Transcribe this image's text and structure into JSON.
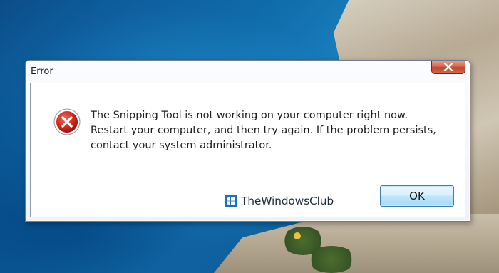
{
  "dialog": {
    "title": "Error",
    "message": "The Snipping Tool is not working on your computer right now. Restart your computer, and then try again. If the problem persists, contact your system administrator.",
    "ok_label": "OK"
  },
  "watermark": {
    "text": "TheWindowsClub"
  },
  "icons": {
    "close": "close-icon",
    "error": "error-icon",
    "logo": "windows-logo-icon"
  },
  "colors": {
    "error_red": "#cc1f1f",
    "close_button": "#c2432b",
    "ok_button_border": "#3c7fb1",
    "sea": "#0f6aa8"
  }
}
